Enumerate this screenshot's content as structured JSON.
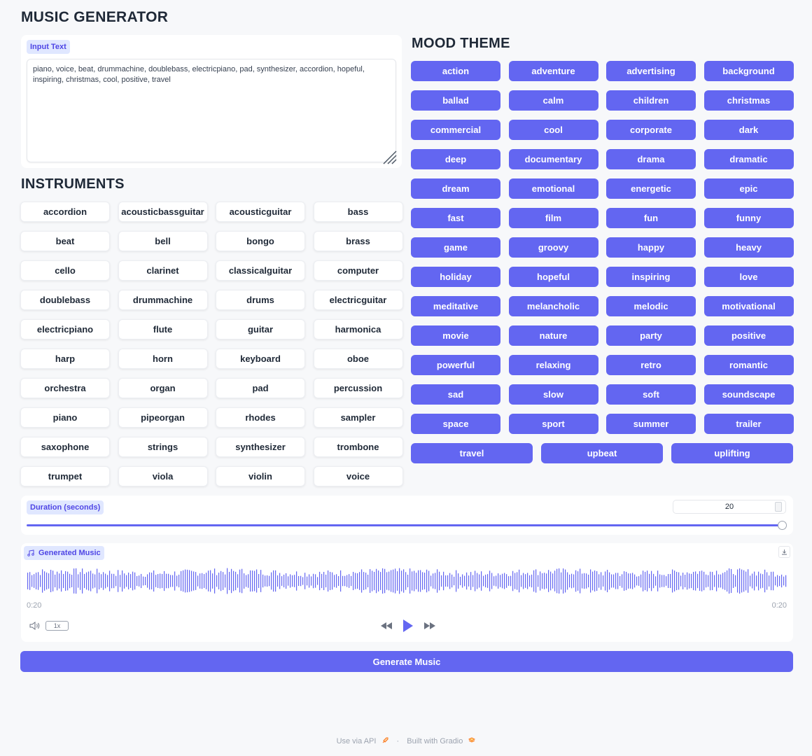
{
  "app_title": "MUSIC GENERATOR",
  "input": {
    "label": "Input Text",
    "value": "piano, voice, beat, drummachine, doublebass, electricpiano, pad, synthesizer, accordion, hopeful, inspiring, christmas, cool, positive, travel"
  },
  "instruments": {
    "heading": "INSTRUMENTS",
    "items": [
      "accordion",
      "acousticbassguitar",
      "acousticguitar",
      "bass",
      "beat",
      "bell",
      "bongo",
      "brass",
      "cello",
      "clarinet",
      "classicalguitar",
      "computer",
      "doublebass",
      "drummachine",
      "drums",
      "electricguitar",
      "electricpiano",
      "flute",
      "guitar",
      "harmonica",
      "harp",
      "horn",
      "keyboard",
      "oboe",
      "orchestra",
      "organ",
      "pad",
      "percussion",
      "piano",
      "pipeorgan",
      "rhodes",
      "sampler",
      "saxophone",
      "strings",
      "synthesizer",
      "trombone",
      "trumpet",
      "viola",
      "violin",
      "voice"
    ]
  },
  "mood": {
    "heading": "MOOD THEME",
    "items": [
      "action",
      "adventure",
      "advertising",
      "background",
      "ballad",
      "calm",
      "children",
      "christmas",
      "commercial",
      "cool",
      "corporate",
      "dark",
      "deep",
      "documentary",
      "drama",
      "dramatic",
      "dream",
      "emotional",
      "energetic",
      "epic",
      "fast",
      "film",
      "fun",
      "funny",
      "game",
      "groovy",
      "happy",
      "heavy",
      "holiday",
      "hopeful",
      "inspiring",
      "love",
      "meditative",
      "melancholic",
      "melodic",
      "motivational",
      "movie",
      "nature",
      "party",
      "positive",
      "powerful",
      "relaxing",
      "retro",
      "romantic",
      "sad",
      "slow",
      "soft",
      "soundscape",
      "space",
      "sport",
      "summer",
      "trailer",
      "travel",
      "upbeat",
      "uplifting"
    ]
  },
  "duration": {
    "label": "Duration (seconds)",
    "value": "20",
    "slider_fraction": 1.0
  },
  "audio": {
    "label": "Generated Music",
    "current_time": "0:20",
    "total_time": "0:20",
    "rate": "1x",
    "icons": {
      "label": "music-note-icon",
      "download": "download-icon",
      "volume": "volume-icon",
      "rewind": "rewind-icon",
      "play": "play-icon",
      "forward": "fast-forward-icon"
    }
  },
  "generate_button": "Generate Music",
  "footer": {
    "api": "Use via API",
    "separator": "·",
    "built": "Built with Gradio"
  },
  "colors": {
    "accent": "#6366f1",
    "label_bg": "#e0e7ff",
    "background": "#f7f8fa"
  }
}
